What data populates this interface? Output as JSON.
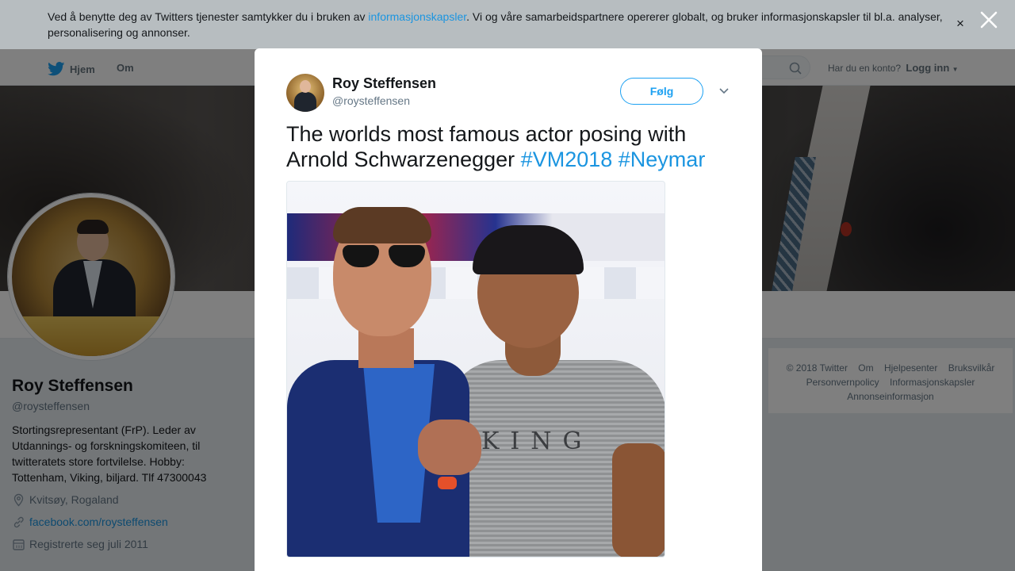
{
  "cookie_banner": {
    "text_before": "Ved å benytte deg av Twitters tjenester samtykker du i bruken av ",
    "link": "informasjonskapsler",
    "text_after": ". Vi og våre samarbeidspartnere opererer globalt, og bruker informasjonskapsler til bl.a. analyser, personalisering og annonser.",
    "close_label": "×"
  },
  "nav": {
    "home": "Hjem",
    "about": "Om",
    "login_prompt": "Har du en konto?",
    "login_link": "Logg inn"
  },
  "profile": {
    "name": "Roy Steffensen",
    "handle": "@roysteffensen",
    "bio": "Stortingsrepresentant (FrP). Leder av Utdannings- og forskningskomiteen, til twitteratets store fortvilelse. Hobby: Tottenham, Viking, biljard. Tlf 47300043",
    "location": "Kvitsøy, Rogaland",
    "website": "facebook.com/roysteffensen",
    "joined": "Registrerte seg juli 2011"
  },
  "footer": {
    "links": [
      "© 2018 Twitter",
      "Om",
      "Hjelpesenter",
      "Bruksvilkår",
      "Personvernpolicy",
      "Informasjonskapsler",
      "Annonseinformasjon"
    ]
  },
  "tweet": {
    "author_name": "Roy Steffensen",
    "author_handle": "@roysteffensen",
    "follow_label": "Følg",
    "text": "The worlds most famous actor posing with Arnold Schwarzenegger ",
    "hashtag1": "#VM2018",
    "hashtag2": "#Neymar",
    "photo_shirt_text": "KING"
  },
  "colors": {
    "accent": "#1da1f2",
    "link": "#1b95e0"
  }
}
